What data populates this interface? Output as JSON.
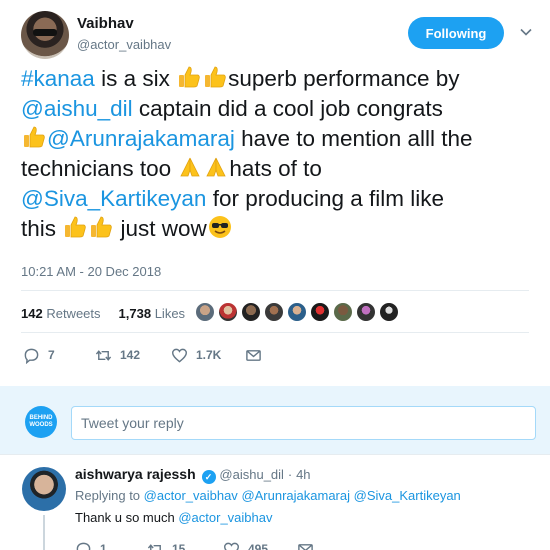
{
  "tweet": {
    "author_name": "Vaibhav",
    "author_handle": "@actor_vaibhav",
    "follow_label": "Following",
    "text": {
      "l1_link": "#kanaa",
      "l1_a": " is a six ",
      "l1_b": "superb performance by",
      "l2_link": "@aishu_dil",
      "l2_a": " captain did a cool job congrats",
      "l3_link": "@Arunrajakamaraj",
      "l3_a": " have to mention alll the",
      "l4_a": "technicians too ",
      "l4_b": "hats of to",
      "l5_link": "@Siva_Kartikeyan",
      "l5_a": " for producing a film like",
      "l6_a": "this ",
      "l6_b": " just wow"
    },
    "timestamp": "10:21 AM - 20 Dec 2018",
    "retweets_count": "142",
    "retweets_label": "Retweets",
    "likes_count": "1,738",
    "likes_label": "Likes",
    "actions": {
      "replies": "7",
      "retweets": "142",
      "likes": "1.7K"
    }
  },
  "reply_box": {
    "logo_text": "BEHIND WOODS",
    "placeholder": "Tweet your reply"
  },
  "reply": {
    "author_name": "aishwarya rajessh",
    "author_handle": "@aishu_dil",
    "time": "4h",
    "replying_label": "Replying to",
    "replying_1": "@actor_vaibhav",
    "replying_2": "@Arunrajakamaraj",
    "replying_3": "@Siva_Kartikeyan",
    "body": "Thank u so much",
    "body_link": "@actor_vaibhav",
    "actions": {
      "replies": "1",
      "retweets": "15",
      "likes": "495"
    }
  },
  "colors": {
    "accent": "#1da1f2",
    "link": "#1b95e0",
    "muted": "#657786",
    "reply_bg": "#e8f5fd"
  }
}
